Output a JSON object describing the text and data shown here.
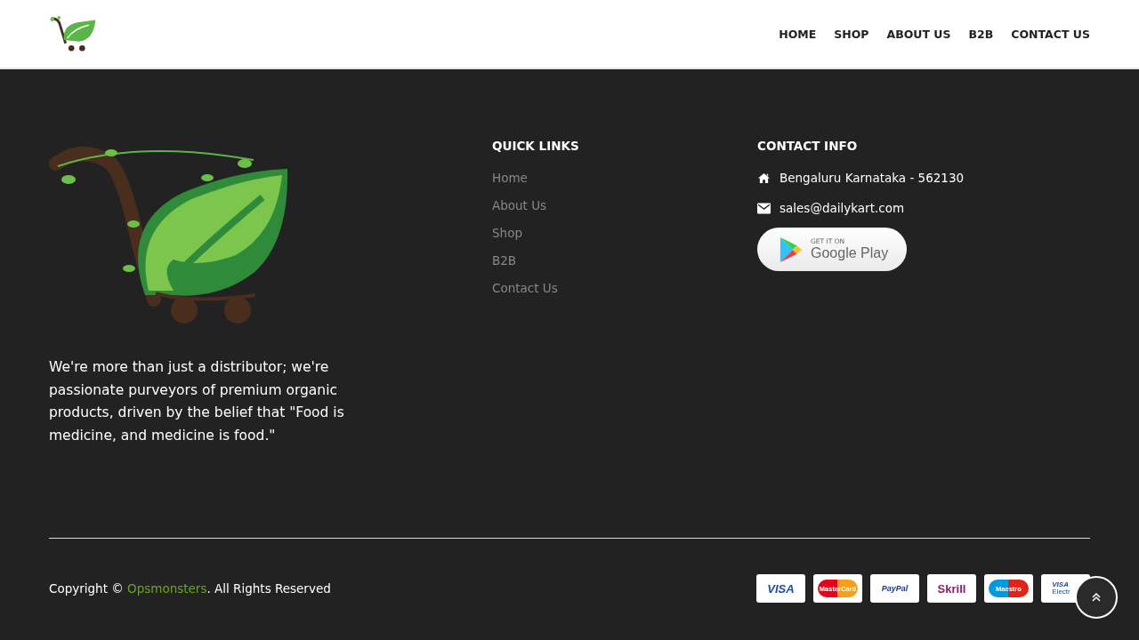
{
  "header": {
    "nav": [
      "HOME",
      "SHOP",
      "ABOUT US",
      "B2B",
      "CONTACT US"
    ]
  },
  "footer": {
    "about": "We're more than just a distributor; we're passionate purveyors of premium organic products, driven by the belief that \"Food is medicine, and medicine is food.\"",
    "quick_links": {
      "title": "QUICK LINKS",
      "items": [
        "Home",
        "About Us",
        "Shop",
        "B2B",
        "Contact Us"
      ]
    },
    "contact": {
      "title": "CONTACT INFO",
      "address": "Bengaluru Karnataka - 562130",
      "email": "sales@dailykart.com",
      "store_badge": {
        "small": "GET IT ON",
        "large": "Google Play"
      }
    },
    "copyright": {
      "before": "Copyright © ",
      "link": "Opsmonsters",
      "after": ". All Rights Reserved"
    },
    "payments": [
      {
        "kind": "visa",
        "label": "VISA"
      },
      {
        "kind": "mastercard",
        "label": "MasterCard"
      },
      {
        "kind": "paypal",
        "label": "PayPal"
      },
      {
        "kind": "skrill",
        "label": "Skrill"
      },
      {
        "kind": "maestro",
        "label": "Maestro"
      },
      {
        "kind": "electron",
        "label": "VISA",
        "sub": "Electr"
      }
    ]
  }
}
